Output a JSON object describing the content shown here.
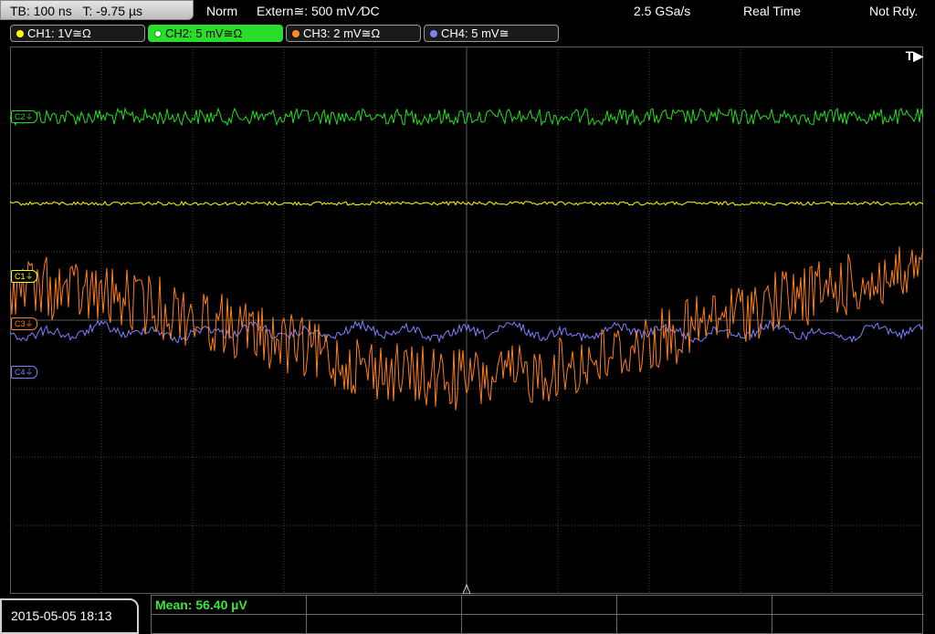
{
  "header": {
    "timebase": "TB: 100 ns",
    "trigger_time": "T: -9.75 µs",
    "acq_mode": "Norm",
    "trigger": "Extern≅: 500 mV ⁄DC",
    "sample_rate": "2.5 GSa/s",
    "realtime": "Real Time",
    "status": "Not Rdy."
  },
  "channels": [
    {
      "label": "CH1: 1V≅Ω",
      "color": "#ffff00"
    },
    {
      "label": "CH2: 5 mV≅Ω",
      "color": "#2bdc2b"
    },
    {
      "label": "CH3: 2 mV≅Ω",
      "color": "#ff8c2a"
    },
    {
      "label": "CH4: 5 mV≅",
      "color": "#8080ff"
    }
  ],
  "trigger_indicator": "T▶",
  "markers": {
    "c1": "C1⏚",
    "c2": "C2⏚",
    "c3": "C3⏚",
    "c4": "C4⏚"
  },
  "colors": {
    "ch1": "#ffff00",
    "ch2": "#22dd22",
    "ch3": "#ff7f1a",
    "ch4": "#7f7fff",
    "grid": "#4a4a4a"
  },
  "footer": {
    "datetime": "2015-05-05 18:13",
    "measurement": "Mean: 56.40 µV"
  }
}
